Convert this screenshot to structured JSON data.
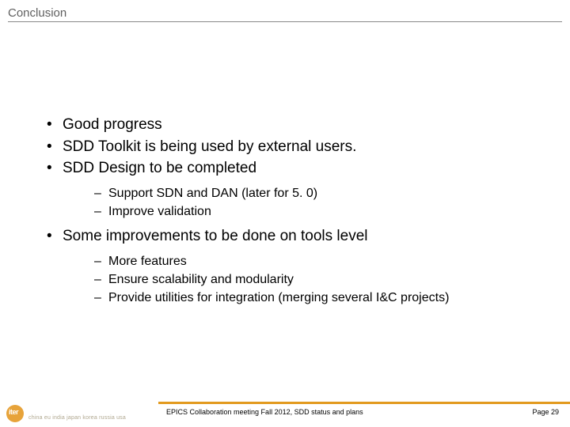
{
  "header": {
    "title": "Conclusion"
  },
  "bullets": {
    "b1": "Good progress",
    "b2": "SDD Toolkit is being used by external users.",
    "b3": "SDD Design to be completed",
    "b3_sub": {
      "s1": "Support SDN and DAN (later for 5. 0)",
      "s2": "Improve validation"
    },
    "b4": "Some improvements to be done on tools level",
    "b4_sub": {
      "s1": "More features",
      "s2": "Ensure scalability and modularity",
      "s3": "Provide utilities for integration (merging several I&C projects)"
    }
  },
  "footer": {
    "center": "EPICS Collaboration meeting  Fall 2012, SDD status and plans",
    "right": "Page 29",
    "logo_members": "china eu india japan korea russia usa"
  }
}
